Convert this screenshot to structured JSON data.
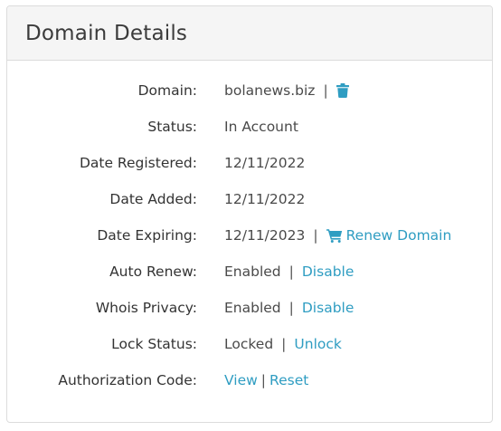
{
  "panel": {
    "title": "Domain Details"
  },
  "colors": {
    "accent": "#2f9dc2",
    "header_bg": "#f5f5f5",
    "border": "#dcdcdc"
  },
  "rows": {
    "domain": {
      "label": "Domain:",
      "value": "bolanews.biz",
      "separator": "|",
      "icon": "trash-icon"
    },
    "status": {
      "label": "Status:",
      "value": "In Account"
    },
    "date_registered": {
      "label": "Date Registered:",
      "value": "12/11/2022"
    },
    "date_added": {
      "label": "Date Added:",
      "value": "12/11/2022"
    },
    "date_expiring": {
      "label": "Date Expiring:",
      "value": "12/11/2023",
      "separator": "|",
      "icon": "cart-icon",
      "action": "Renew Domain"
    },
    "auto_renew": {
      "label": "Auto Renew:",
      "value": "Enabled",
      "separator": "|",
      "action": "Disable"
    },
    "whois_privacy": {
      "label": "Whois Privacy:",
      "value": "Enabled",
      "separator": "|",
      "action": "Disable"
    },
    "lock_status": {
      "label": "Lock Status:",
      "value": "Locked",
      "separator": "|",
      "action": "Unlock"
    },
    "authorization_code": {
      "label": "Authorization Code:",
      "view": "View",
      "separator": "|",
      "reset": "Reset"
    }
  }
}
